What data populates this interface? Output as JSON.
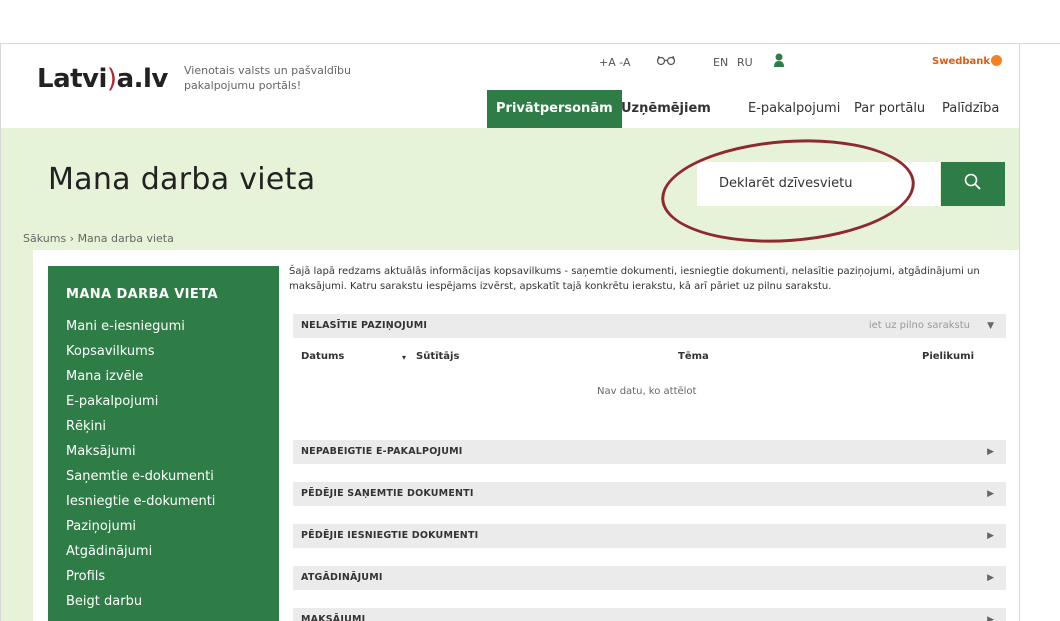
{
  "header": {
    "logo_text": "Latvi",
    "logo_suffix": "a.lv",
    "logo_swirl": ")",
    "tagline": "Vienotais valsts un pašvaldību pakalpojumu portāls!",
    "font_size_controls": "+A -A",
    "lang_en": "EN",
    "lang_ru": "RU",
    "bank_label": "Swedbank",
    "glasses_icon": "glasses-icon",
    "user_icon": "user-icon"
  },
  "nav": {
    "items": [
      "Privātpersonām",
      "Uzņēmējiem",
      "E-pakalpojumi",
      "Par portālu",
      "Palīdzība"
    ],
    "active": "Privātpersonām"
  },
  "page": {
    "title": "Mana darba vieta",
    "breadcrumb": "Sākums › Mana darba vieta"
  },
  "search": {
    "value": "Deklarēt dzīvesvietu",
    "icon": "search-icon"
  },
  "sidebar": {
    "title": "MANA DARBA VIETA",
    "items": [
      "Mani e-iesniegumi",
      "Kopsavilkums",
      "Mana izvēle",
      "E-pakalpojumi",
      "Rēķini",
      "Maksājumi",
      "Saņemtie e-dokumenti",
      "Iesniegtie e-dokumenti",
      "Paziņojumi",
      "Atgādinājumi",
      "Profils",
      "Beigt darbu"
    ]
  },
  "main": {
    "intro": "Šajā lapā redzams aktuālās informācijas kopsavilkums - saņemtie dokumenti, iesniegtie dokumenti, nelasītie paziņojumi, atgādinājumi un maksājumi. Katru sarakstu iespējams izvērst, apskatīt tajā konkrētu ierakstu, kā arī pāriet uz pilnu sarakstu.",
    "sections": [
      {
        "title": "NELASĪTIE PAZIŅOJUMI",
        "link": "iet uz pilno sarakstu",
        "arrow": "▼"
      },
      {
        "title": "NEPABEIGTIE E-PAKALPOJUMI",
        "arrow": "▶"
      },
      {
        "title": "PĒDĒJIE SAŅEMTIE DOKUMENTI",
        "arrow": "▶"
      },
      {
        "title": "PĒDĒJIE IESNIEGTIE DOKUMENTI",
        "arrow": "▶"
      },
      {
        "title": "ATGĀDINĀJUMI",
        "arrow": "▶"
      },
      {
        "title": "MAKSĀJUMI",
        "arrow": "▶"
      }
    ],
    "table": {
      "columns": [
        "Datums",
        "Sūtītājs",
        "Tēma",
        "Pielikumi"
      ],
      "sort_indicator": "▾",
      "empty_text": "Nav datu, ko attēlot"
    }
  },
  "colors": {
    "brand_green": "#2f7d46",
    "band_green": "#e7f3d9",
    "annotation_red": "#8e2a2d"
  }
}
